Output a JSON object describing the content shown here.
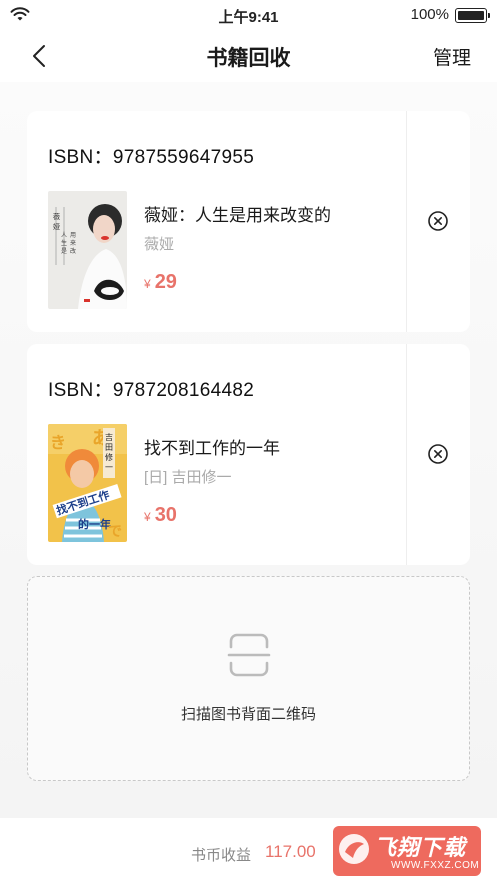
{
  "status_bar": {
    "time": "上午9:41",
    "battery_percent": "100%"
  },
  "nav": {
    "title": "书籍回收",
    "manage_label": "管理"
  },
  "books": [
    {
      "isbn": "ISBN：9787559647955",
      "title": "薇娅：人生是用来改变的",
      "author": "薇娅",
      "currency": "¥",
      "price": "29",
      "cover_text": "薇娅 人生是用来改变的"
    },
    {
      "isbn": "ISBN：9787208164482",
      "title": "找不到工作的一年",
      "author": "[日] 吉田修一",
      "currency": "¥",
      "price": "30",
      "cover_text": "吉田修一 找不到工作的一年"
    }
  ],
  "scan": {
    "label": "扫描图书背面二维码",
    "icon": "scan-icon"
  },
  "bottom": {
    "earn_label": "书币收益",
    "earn_value": "117.00",
    "watermark_text": "飞翔下载",
    "watermark_url": "WWW.FXXZ.COM"
  },
  "colors": {
    "accent": "#e8736a",
    "button": "#ee6a5e"
  }
}
